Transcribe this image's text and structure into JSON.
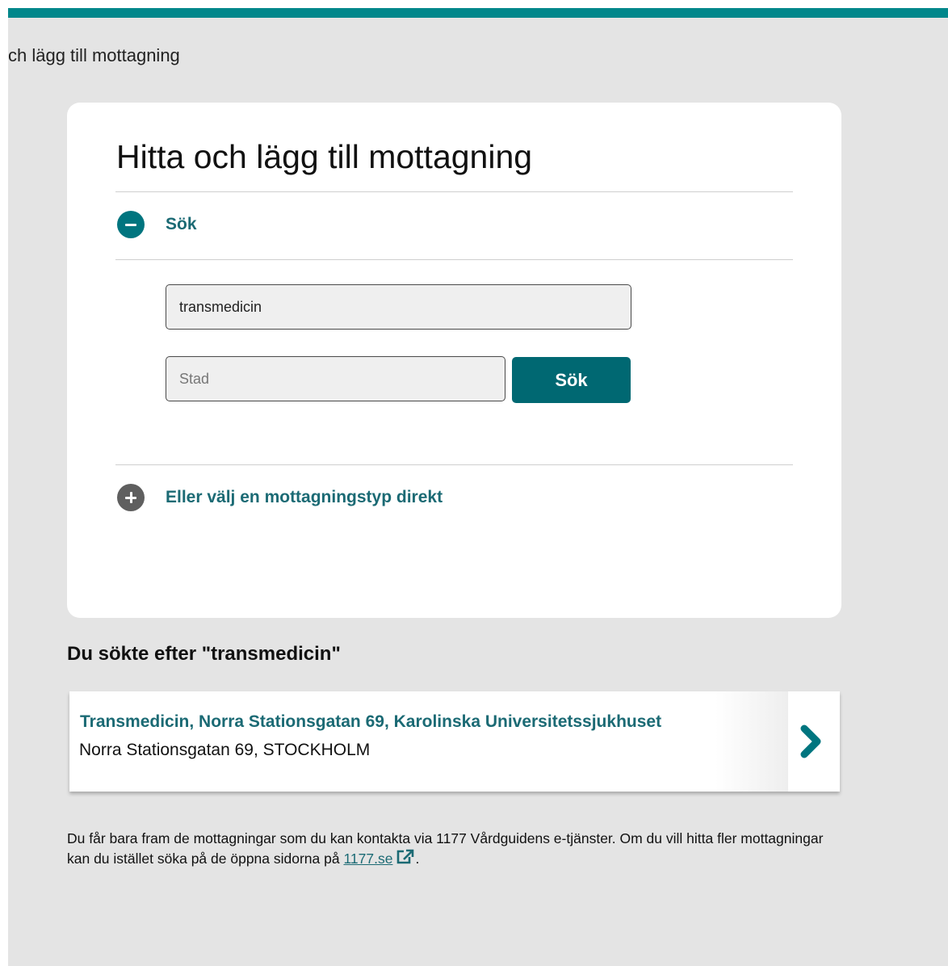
{
  "colors": {
    "brand": "#00878b",
    "accent": "#006872",
    "link": "#1b6a74",
    "page_bg": "#e4e4e4"
  },
  "breadcrumb": {
    "title": "ch lägg till mottagning"
  },
  "card": {
    "title": "Hitta och lägg till mottagning",
    "search_section": {
      "icon": "minus-circle-icon",
      "label": "Sök",
      "expanded": true,
      "query_value": "transmedicin",
      "city_placeholder": "Stad",
      "city_value": "",
      "search_button": "Sök"
    },
    "type_section": {
      "icon": "plus-circle-icon",
      "label": "Eller välj en mottagningstyp direkt",
      "expanded": false
    }
  },
  "results": {
    "heading": "Du sökte efter \"transmedicin\"",
    "items": [
      {
        "name": "Transmedicin, Norra Stationsgatan 69, Karolinska Universitetssjukhuset",
        "address": "Norra Stationsgatan 69, STOCKHOLM",
        "icon": "chevron-right-icon"
      }
    ]
  },
  "footnote": {
    "text_before_link": "Du får bara fram de mottagningar som du kan kontakta via 1177 Vårdguidens e-tjänster. Om du vill hitta fler mottagningar kan du istället söka på de öppna sidorna på ",
    "link_text": "1177.se",
    "link_icon": "external-link-icon",
    "text_after_link": "."
  }
}
